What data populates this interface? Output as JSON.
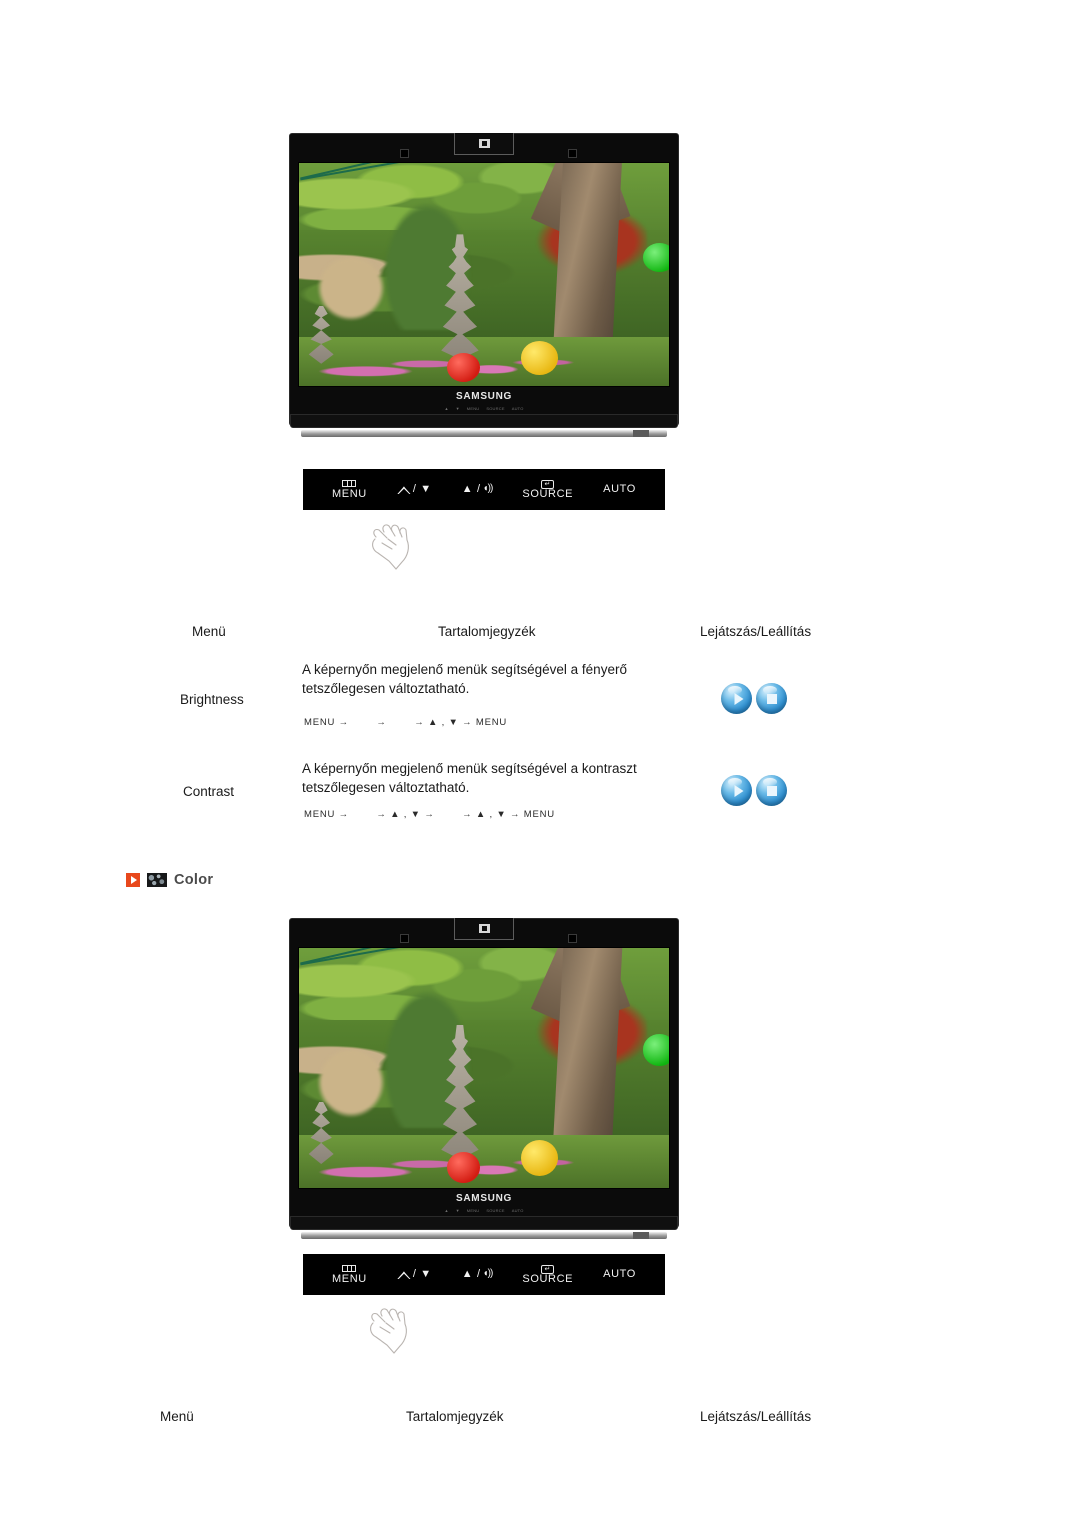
{
  "table": {
    "headers": {
      "menu": "Menü",
      "contents": "Tartalomjegyzék",
      "playstop": "Lejátszás/Leállítás"
    },
    "rows": [
      {
        "label": "Brightness",
        "description": "A képernyőn megjelenő menük segítségével a fényerő tetszőlegesen változtatható.",
        "sequence": "MENU →        →        → ▲ , ▼ → MENU"
      },
      {
        "label": "Contrast",
        "description": "A képernyőn megjelenő menük segítségével a kontraszt tetszőlegesen változtatható.",
        "sequence": "MENU →        → ▲ , ▼ →        → ▲ , ▼ → MENU"
      }
    ]
  },
  "section": {
    "title": "Color"
  },
  "monitor": {
    "brand": "SAMSUNG",
    "key_labels": [
      "AUTO",
      "SOURCE",
      "MENU",
      "▲",
      "▼"
    ]
  },
  "button_bar": {
    "menu_label": "MENU",
    "brightness_down_label": "/ ▼",
    "up_volume_label": "▲ /",
    "source_label": "SOURCE",
    "auto_label": "AUTO"
  },
  "colors": {
    "accent": "#e8481c",
    "orb": "#2f8fd0",
    "bezel": "#0b0b0b",
    "text": "#1a1a1a"
  },
  "bottom_repeat": {
    "menu": "Menü",
    "contents": "Tartalomjegyzék",
    "playstop": "Lejátszás/Leállítás"
  }
}
